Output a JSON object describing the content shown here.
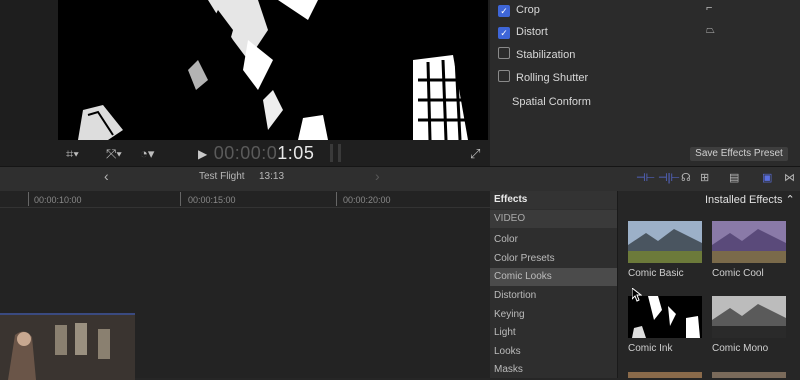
{
  "viewer": {
    "timecode_dim": "00:00:0",
    "timecode_live": "1:05",
    "play_icon": "play-icon"
  },
  "inspector": {
    "rows": [
      {
        "label": "Crop",
        "checked": true
      },
      {
        "label": "Distort",
        "checked": true
      },
      {
        "label": "Stabilization",
        "checked": false
      },
      {
        "label": "Rolling Shutter",
        "checked": false
      }
    ],
    "spatial_conform": "Spatial Conform",
    "save_button": "Save Effects Preset"
  },
  "toolbar": {
    "back_arrow": "‹",
    "forward_arrow": "›",
    "project_name": "Test Flight",
    "duration": "13:13"
  },
  "timeline": {
    "ticks": [
      "00:00:10:00",
      "00:00:15:00",
      "00:00:20:00"
    ]
  },
  "effects": {
    "header": "Effects",
    "installed_label": "Installed Effects ⌃",
    "categories": [
      "VIDEO",
      "Color",
      "Color Presets",
      "Comic Looks",
      "Distortion",
      "Keying",
      "Light",
      "Looks",
      "Masks"
    ],
    "selected": "Comic Looks",
    "items": [
      "Comic Basic",
      "Comic Cool",
      "Comic Ink",
      "Comic Mono"
    ]
  },
  "colors": {
    "accent": "#4a3c8c",
    "checkbox_on": "#3e66d8"
  }
}
